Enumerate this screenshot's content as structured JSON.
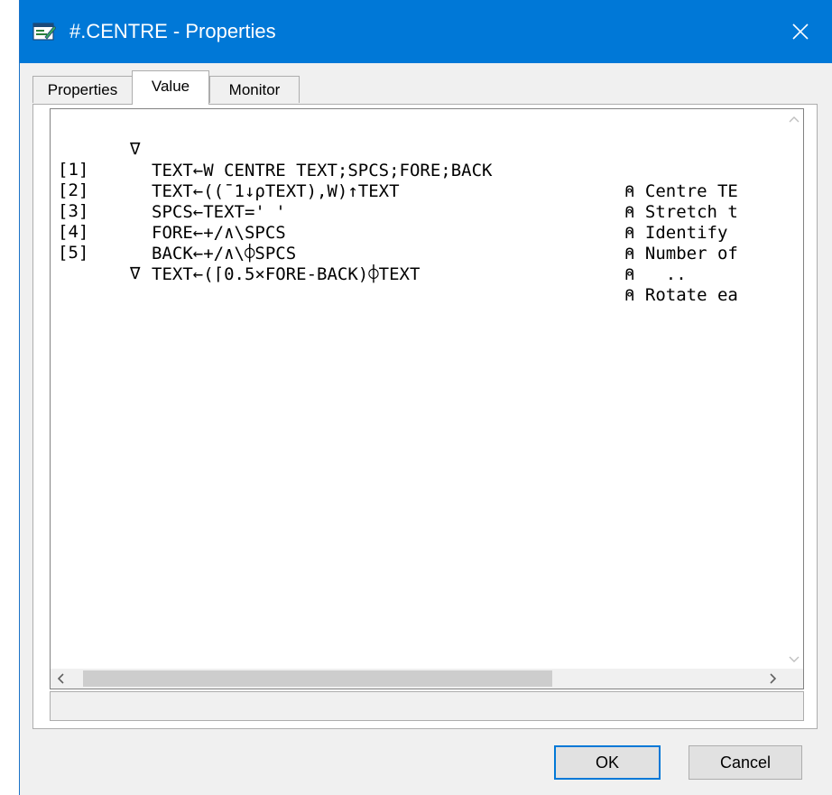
{
  "window": {
    "title": "#.CENTRE - Properties",
    "accent_color": "#0078d7",
    "icon": "properties-window-icon"
  },
  "tabs": [
    {
      "label": "Properties",
      "active": false
    },
    {
      "label": "Value",
      "active": true
    },
    {
      "label": "Monitor",
      "active": false
    }
  ],
  "code": {
    "header_nabla": "∇",
    "header_src": "TEXT←W CENTRE TEXT;SPCS;FORE;BACK",
    "header_comment": "⍝ Centre TE",
    "lines": [
      {
        "num": "[1]",
        "src": "TEXT←((¯1↓⍴TEXT),W)↑TEXT",
        "comment": "⍝ Stretch t"
      },
      {
        "num": "[2]",
        "src": "SPCS←TEXT=' '",
        "comment": "⍝ Identify "
      },
      {
        "num": "[3]",
        "src": "FORE←+/∧\\SPCS",
        "comment": "⍝ Number of"
      },
      {
        "num": "[4]",
        "src": "BACK←+/∧\\⌽SPCS",
        "comment": "⍝   .."
      },
      {
        "num": "[5]",
        "src": "TEXT←(⌈0.5×FORE-BACK)⌽TEXT",
        "comment": "⍝ Rotate ea"
      }
    ],
    "footer_nabla": "∇"
  },
  "scrollbars": {
    "horizontal_thumb_fraction": 0.66
  },
  "buttons": {
    "ok_label": "OK",
    "cancel_label": "Cancel"
  }
}
